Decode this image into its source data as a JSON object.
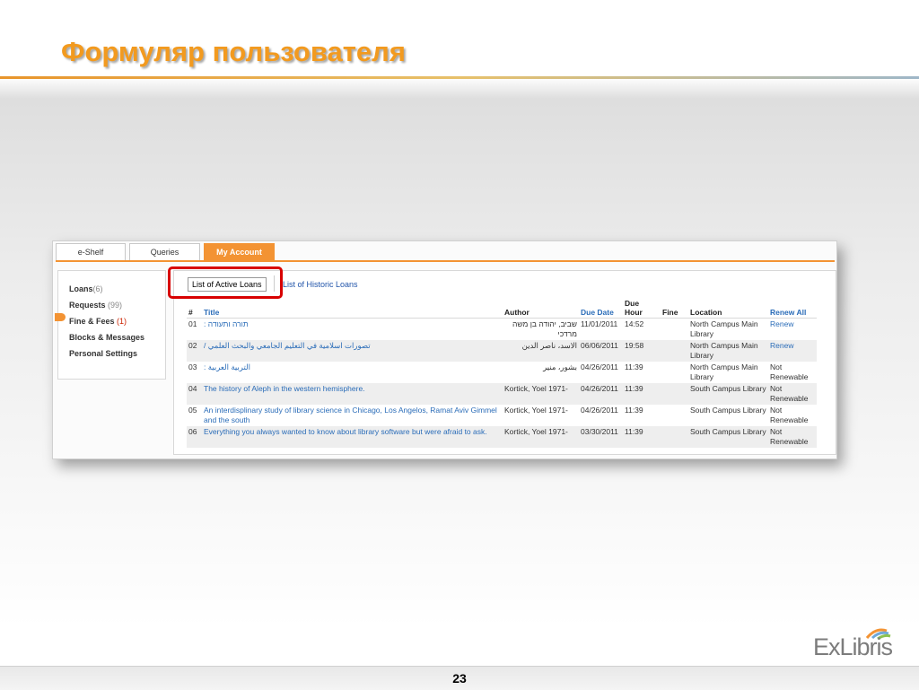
{
  "slide": {
    "title": "Формуляр пользователя",
    "page_number": "23",
    "logo_text": "ExLibris"
  },
  "tabs": [
    {
      "label": "e-Shelf",
      "active": false
    },
    {
      "label": "Queries",
      "active": false
    },
    {
      "label": "My Account",
      "active": true
    }
  ],
  "sidebar": {
    "items": [
      {
        "label": "Loans",
        "count": "(6)",
        "active": true
      },
      {
        "label": "Requests",
        "count": "(99)"
      },
      {
        "label": "Fine & Fees",
        "count": "(1)"
      },
      {
        "label": "Blocks & Messages",
        "count": ""
      },
      {
        "label": "Personal Settings",
        "count": ""
      }
    ]
  },
  "subtabs": {
    "active": "List of Active Loans",
    "other": "List of Historic Loans"
  },
  "table": {
    "headers": {
      "num": "#",
      "title": "Title",
      "author": "Author",
      "due_date": "Due Date",
      "due_hour": "Due Hour",
      "fine": "Fine",
      "location": "Location",
      "renew_all": "Renew All"
    },
    "rows": [
      {
        "num": "01",
        "title": "תורה ותעודה :",
        "author": "שביב, יהודה בן משה מרדכי",
        "due_date": "11/01/2011",
        "due_hour": "14:52",
        "fine": "",
        "location": "North Campus Main Library",
        "renew": "Renew"
      },
      {
        "num": "02",
        "title": "تصورات اسلامية في التعليم الجامعي والبحث العلمي /",
        "author": "الاسد، ناصر الدين",
        "due_date": "06/06/2011",
        "due_hour": "19:58",
        "fine": "",
        "location": "North Campus Main Library",
        "renew": "Renew"
      },
      {
        "num": "03",
        "title": "التربية العربية :",
        "author": "بشور، منير",
        "due_date": "04/26/2011",
        "due_hour": "11:39",
        "fine": "",
        "location": "North Campus Main Library",
        "renew": "Not Renewable"
      },
      {
        "num": "04",
        "title": "The history of Aleph in the western hemisphere.",
        "author": "Kortick, Yoel 1971-",
        "due_date": "04/26/2011",
        "due_hour": "11:39",
        "fine": "",
        "location": "South Campus Library",
        "renew": "Not Renewable"
      },
      {
        "num": "05",
        "title": "An interdisplinary study of library science in Chicago, Los Angelos, Ramat Aviv Gimmel and the south",
        "author": "Kortick, Yoel 1971-",
        "due_date": "04/26/2011",
        "due_hour": "11:39",
        "fine": "",
        "location": "South Campus Library",
        "renew": "Not Renewable"
      },
      {
        "num": "06",
        "title": "Everything you always wanted to know about library software but were afraid to ask.",
        "author": "Kortick, Yoel 1971-",
        "due_date": "03/30/2011",
        "due_hour": "11:39",
        "fine": "",
        "location": "South Campus Library",
        "renew": "Not Renewable"
      }
    ]
  },
  "colors": {
    "accent": "#f39333",
    "title": "#f29a1f",
    "link": "#2a6cb8",
    "highlight": "#d80000"
  }
}
